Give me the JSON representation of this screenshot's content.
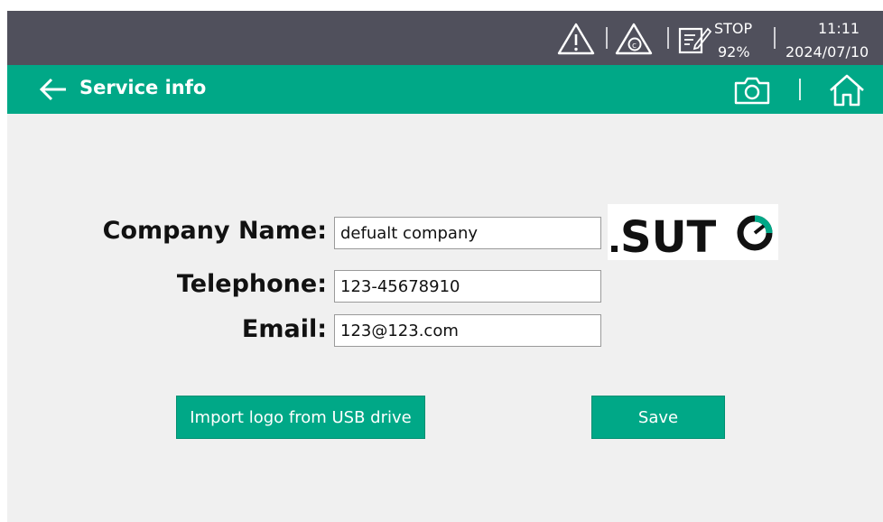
{
  "statusbar": {
    "stop_label": "STOP",
    "stop_percent": "92%",
    "time": "11:11",
    "date": "2024/07/10",
    "icons": [
      "warning-icon",
      "calibration-warning-icon",
      "notes-edit-icon"
    ]
  },
  "titlebar": {
    "title": "Service info",
    "icons": [
      "back-arrow-icon",
      "camera-icon",
      "home-icon"
    ]
  },
  "form": {
    "company_label": "Company Name:",
    "company_value": "defualt company",
    "telephone_label": "Telephone:",
    "telephone_value": "123-45678910",
    "email_label": "Email:",
    "email_value": "123@123.com"
  },
  "logo": {
    "text": ".SUTO"
  },
  "buttons": {
    "import_logo": "Import logo from USB drive",
    "save": "Save"
  },
  "colors": {
    "accent": "#00a887",
    "statusbar": "#50505c",
    "background": "#f0f0f0"
  }
}
